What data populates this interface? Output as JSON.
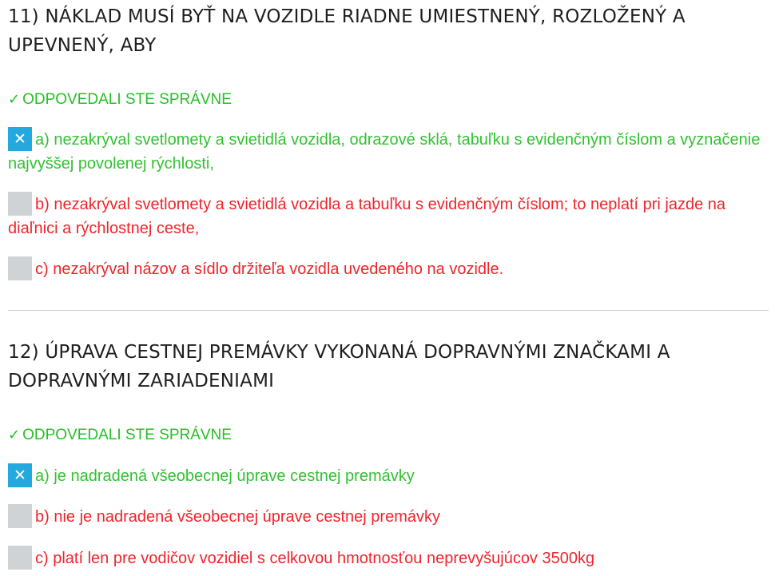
{
  "questions": [
    {
      "title": "11) NÁKLAD MUSÍ BYŤ NA VOZIDLE RIADNE UMIESTNENÝ, ROZLOŽENÝ A UPEVNENÝ, ABY",
      "status_icon": "✓",
      "status": "ODPOVEDALI STE SPRÁVNE",
      "answers": [
        {
          "mark": "✕",
          "text": "a) nezakrýval svetlomety a svietidlá vozidla, odrazové sklá, tabuľku s evidenčným číslom a vyznačenie najvyššej povolenej rýchlosti,",
          "correct": true,
          "selected": true
        },
        {
          "mark": "",
          "text": "b) nezakrýval svetlomety a svietidlá vozidla a tabuľku s evidenčným číslom; to neplatí pri jazde na diaľnici a rýchlostnej ceste,",
          "correct": false,
          "selected": false
        },
        {
          "mark": "",
          "text": "c) nezakrýval názov a sídlo držiteľa vozidla uvedeného na vozidle.",
          "correct": false,
          "selected": false
        }
      ]
    },
    {
      "title": "12) ÚPRAVA CESTNEJ PREMÁVKY VYKONANÁ DOPRAVNÝMI ZNAČKAMI A DOPRAVNÝMI ZARIADENIAMI",
      "status_icon": "✓",
      "status": "ODPOVEDALI STE SPRÁVNE",
      "answers": [
        {
          "mark": "✕",
          "text": "a) je nadradená všeobecnej úprave cestnej premávky",
          "correct": true,
          "selected": true
        },
        {
          "mark": "",
          "text": "b) nie je nadradená všeobecnej úprave cestnej premávky",
          "correct": false,
          "selected": false
        },
        {
          "mark": "",
          "text": "c) platí len pre vodičov vozidiel s celkovou hmotnosťou neprevyšujúcov 3500kg",
          "correct": false,
          "selected": false
        }
      ]
    }
  ],
  "colors": {
    "correct": "#33c133",
    "wrong": "#f0242c",
    "selected_mark": "#23a9de",
    "empty_mark": "#d0d3d6"
  }
}
